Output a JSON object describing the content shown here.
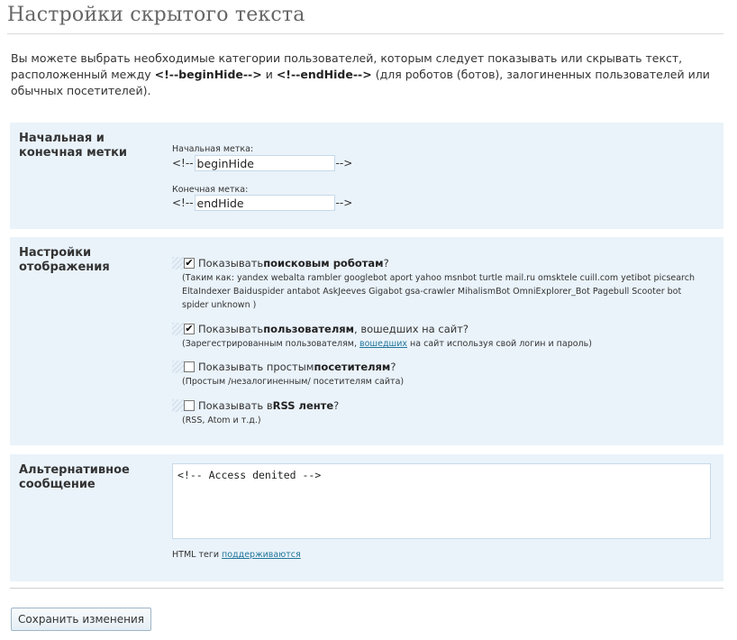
{
  "page": {
    "title": "Настройки скрытого текста",
    "intro_part1": "Вы можете выбрать необходимые категории пользователей, которым следует показывать или скрывать текст, расположенный между ",
    "intro_tag_begin": "<!--beginHide-->",
    "intro_and": " и ",
    "intro_tag_end": "<!--endHide-->",
    "intro_part2": " (для роботов (ботов), залогиненных пользователей или обычных посетителей)."
  },
  "tags_section": {
    "label": "Начальная и конечная метки",
    "begin_label": "Начальная метка:",
    "begin_prefix": "<!--",
    "begin_value": "beginHide",
    "begin_suffix": "-->",
    "end_label": "Конечная метка:",
    "end_prefix": "<!--",
    "end_value": "endHide",
    "end_suffix": "-->"
  },
  "display_section": {
    "label": "Настройки отображения",
    "options": [
      {
        "checked": true,
        "text_pre": "Показывать ",
        "text_bold": "поисковым роботам",
        "text_post": "?",
        "desc": "(Таким как: yandex webalta rambler googlebot aport yahoo msnbot turtle mail.ru omsktele cuill.com yetibot picsearch EltaIndexer Baiduspider antabot AskJeeves Gigabot gsa-crawler MihalismBot OmniExplorer_Bot Pagebull Scooter bot spider unknown )"
      },
      {
        "checked": true,
        "text_pre": "Показывать ",
        "text_bold": "пользователям",
        "text_post": ", вошедших на сайт?",
        "desc_pre": "(Зарегестрированным пользователям, ",
        "desc_link": "вошедших",
        "desc_post": " на сайт используя свой логин и пароль)"
      },
      {
        "checked": false,
        "text_pre": "Показывать простым ",
        "text_bold": "посетителям",
        "text_post": "?",
        "desc": "(Простым /незалогиненным/ посетителям сайта)"
      },
      {
        "checked": false,
        "text_pre": "Показывать в ",
        "text_bold": "RSS ленте",
        "text_post": "?",
        "desc": "(RSS, Atom и т.д.)"
      }
    ]
  },
  "alt_section": {
    "label": "Альтернативное сообщение",
    "message": "<!-- Access denited -->",
    "note_pre": "HTML теги ",
    "note_link": "поддерживаются"
  },
  "actions": {
    "save_label": "Сохранить изменения"
  },
  "colors": {
    "section_bg": "#eaf3fa",
    "link": "#21759b"
  }
}
